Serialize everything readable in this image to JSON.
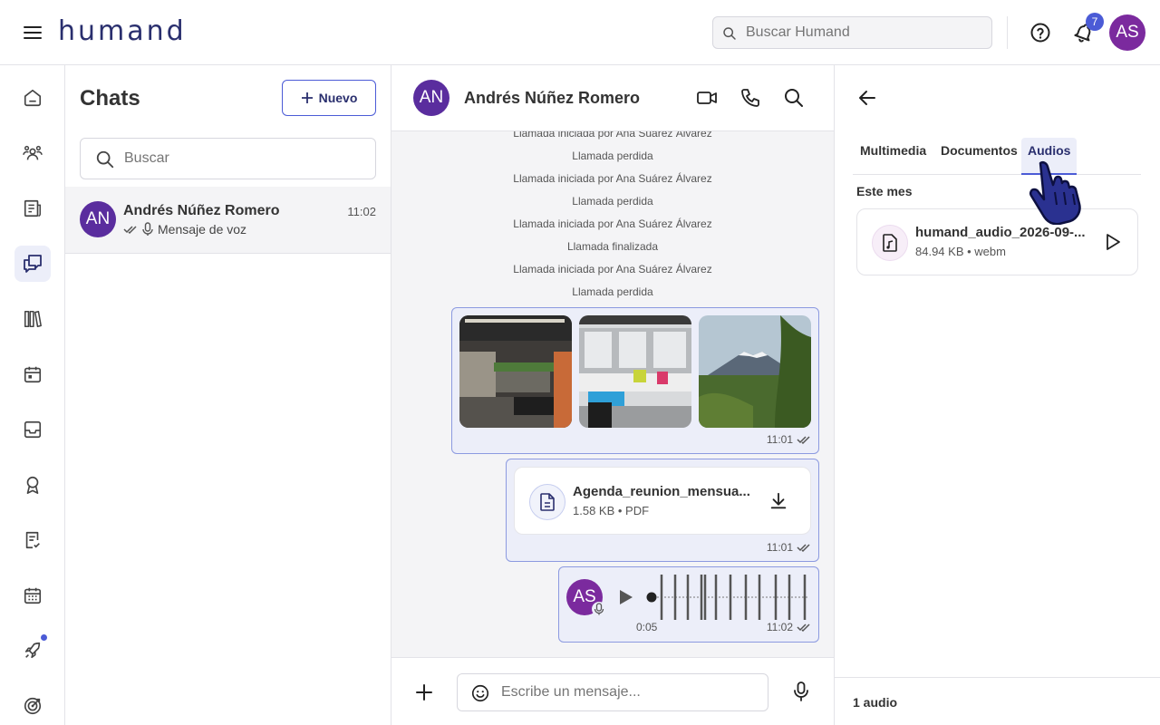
{
  "app": {
    "logo": "humand"
  },
  "topbar": {
    "search_placeholder": "Buscar Humand",
    "notification_count": "7",
    "user_initials": "AS"
  },
  "colors": {
    "accent": "#4b5bd6",
    "brand_dark": "#2a2f6e",
    "avatar_user": "#7b2a9e",
    "avatar_contact": "#5a2d9e"
  },
  "leftnav": {
    "items": [
      {
        "icon": "home-icon"
      },
      {
        "icon": "people-icon"
      },
      {
        "icon": "news-icon"
      },
      {
        "icon": "chat-icon",
        "active": true
      },
      {
        "icon": "library-icon"
      },
      {
        "icon": "calendar-icon"
      },
      {
        "icon": "inbox-icon"
      },
      {
        "icon": "award-icon"
      },
      {
        "icon": "checklist-icon"
      },
      {
        "icon": "schedule-icon"
      },
      {
        "icon": "rocket-icon",
        "badge": true
      },
      {
        "icon": "target-icon"
      }
    ]
  },
  "chatlist": {
    "title": "Chats",
    "new_label": "Nuevo",
    "search_placeholder": "Buscar",
    "chats": [
      {
        "initials": "AN",
        "name": "Andrés Núñez Romero",
        "time": "11:02",
        "preview": "Mensaje de voz"
      }
    ]
  },
  "conversation": {
    "contact_initials": "AN",
    "contact_name": "Andrés Núñez Romero",
    "system_messages": [
      "Llamada iniciada por Ana Suárez Álvarez",
      "Llamada perdida",
      "Llamada iniciada por Ana Suárez Álvarez",
      "Llamada perdida",
      "Llamada iniciada por Ana Suárez Álvarez",
      "Llamada finalizada",
      "Llamada iniciada por Ana Suárez Álvarez",
      "Llamada perdida"
    ],
    "images_message": {
      "time": "11:01",
      "image_count": 3
    },
    "file_message": {
      "name": "Agenda_reunion_mensua...",
      "meta": "1.58 KB • PDF",
      "time": "11:01"
    },
    "voice_message": {
      "sender_initials": "AS",
      "duration": "0:05",
      "time": "11:02"
    },
    "composer_placeholder": "Escribe un mensaje..."
  },
  "panel": {
    "tabs": [
      "Multimedia",
      "Documentos",
      "Audios"
    ],
    "active_tab": "Audios",
    "section_label": "Este mes",
    "audio": {
      "name": "humand_audio_2026-09-...",
      "meta": "84.94 KB • webm"
    },
    "footer_count": "1 audio"
  }
}
